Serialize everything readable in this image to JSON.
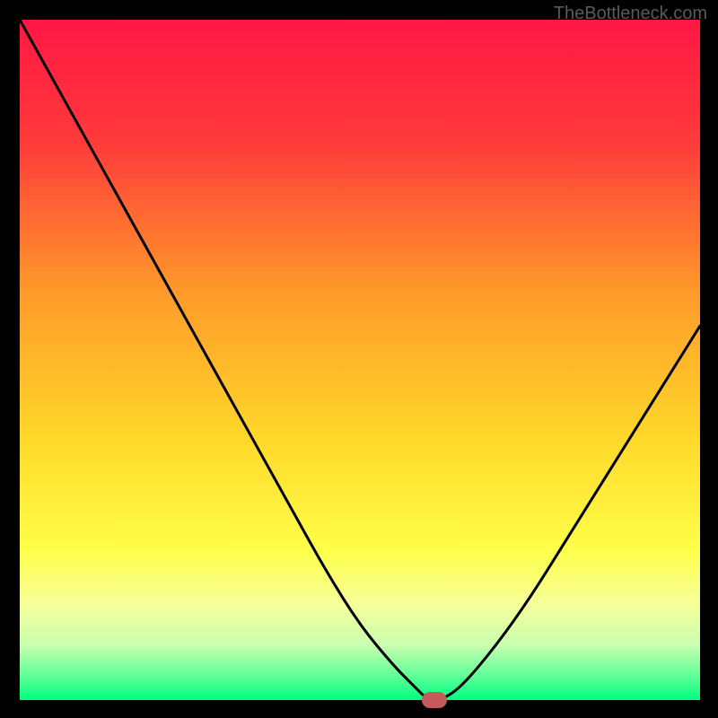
{
  "watermark": "TheBottleneck.com",
  "chart_data": {
    "type": "line",
    "title": "",
    "xlabel": "",
    "ylabel": "",
    "xlim": [
      0,
      100
    ],
    "ylim": [
      0,
      100
    ],
    "x": [
      0,
      5,
      10,
      15,
      20,
      25,
      30,
      35,
      40,
      45,
      50,
      55,
      58,
      60,
      62,
      65,
      70,
      75,
      80,
      85,
      90,
      95,
      100
    ],
    "values": [
      100,
      91,
      82,
      73,
      64,
      55,
      46,
      37,
      28,
      19,
      11,
      5,
      2,
      0,
      0,
      2,
      8,
      15,
      23,
      31,
      39,
      47,
      55
    ],
    "marker": {
      "x": 61,
      "y": 0
    },
    "gradient_stops": [
      {
        "pct": 0,
        "color": "#ff1744"
      },
      {
        "pct": 18,
        "color": "#ff3a3a"
      },
      {
        "pct": 40,
        "color": "#ff9a2a"
      },
      {
        "pct": 62,
        "color": "#ffd92a"
      },
      {
        "pct": 78,
        "color": "#ffff4a"
      },
      {
        "pct": 86,
        "color": "#f6ff9a"
      },
      {
        "pct": 92,
        "color": "#c8ffb0"
      },
      {
        "pct": 96,
        "color": "#6aff9a"
      },
      {
        "pct": 100,
        "color": "#00ff80"
      }
    ]
  }
}
